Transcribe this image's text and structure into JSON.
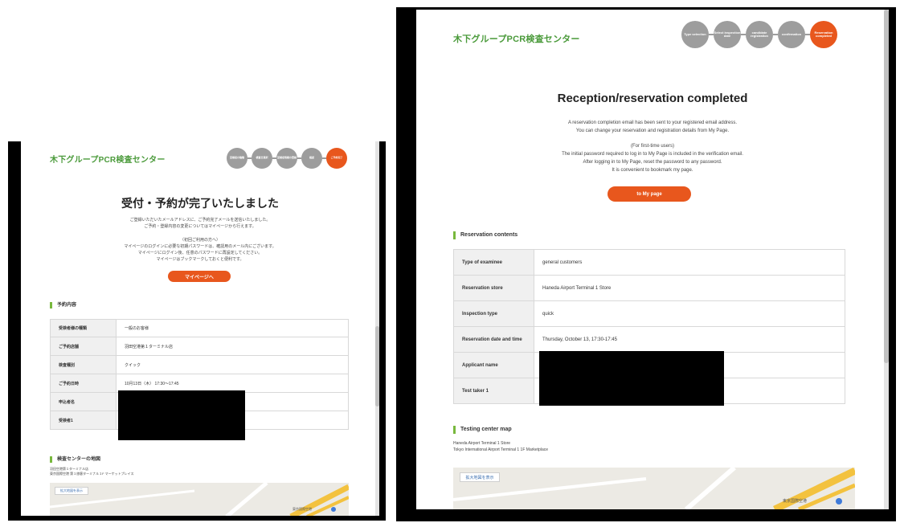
{
  "left": {
    "logo": "木下グループPCR検査センター",
    "steps": [
      "受検者の種類",
      "検査日選択",
      "受検者情報の登録",
      "確認",
      "ご予約完了"
    ],
    "heading": "受付・予約が完了いたしました",
    "message1": [
      "ご登録いただいたメールアドレスに、ご予約完了メールを送信いたしました。",
      "ご予約・登録内容の変更についてはマイページから行えます。"
    ],
    "message2": [
      "（初回ご利用の方へ）",
      "マイページのログインに必要な初期パスワードは、確認用のメール内にございます。",
      "マイページにログイン後、任意のパスワードに再設定してください。",
      "マイページはブックマークしておくと便利です。"
    ],
    "button": "マイページへ",
    "section_title": "予約内容",
    "rows": [
      {
        "label": "受検者様の種類",
        "value": "一般のお客様"
      },
      {
        "label": "ご予約店舗",
        "value": "羽田空港第１ターミナル店"
      },
      {
        "label": "検査種別",
        "value": "クイック"
      },
      {
        "label": "ご予約日時",
        "value": "10月13日（木） 17:30〜17:45"
      },
      {
        "label": "申込者名",
        "value": ""
      },
      {
        "label": "受検者1",
        "value": ""
      }
    ],
    "map_title": "検査センターの地図",
    "address": [
      "羽田空港第１ターミナル店",
      "東京国際空港 第１旅客ターミナル１F マーケットプレイス"
    ],
    "map_button": "拡大地図を表示",
    "map_label": "東京国際空港"
  },
  "right": {
    "logo": "木下グループPCR検査センター",
    "steps": [
      "Type selection",
      "Select inspection date",
      "candidate registration",
      "confirmation",
      "Reservation completed"
    ],
    "heading": "Reception/reservation completed",
    "message1": [
      "A reservation completion email has been sent to your registered email address.",
      "You can change your reservation and registration details from My Page."
    ],
    "message2": [
      "(For first-time users)",
      "The initial password required to log in to My Page is included in the verification email.",
      "After logging in to My Page, reset the password to any password.",
      "It is convenient to bookmark my page."
    ],
    "button": "to My page",
    "section_title": "Reservation contents",
    "rows": [
      {
        "label": "Type of examinee",
        "value": "general customers"
      },
      {
        "label": "Reservation store",
        "value": "Haneda Airport Terminal 1 Store"
      },
      {
        "label": "Inspection type",
        "value": "quick"
      },
      {
        "label": "Reservation date and time",
        "value": "Thursday, October 13, 17:30-17:45"
      },
      {
        "label": "Applicant name",
        "value": ""
      },
      {
        "label": "Test taker 1",
        "value": ""
      }
    ],
    "map_title": "Testing center map",
    "address": [
      "Haneda Airport Terminal 1 Store",
      "Tokyo International Airport Terminal 1 1F Marketplace"
    ],
    "map_button": "拡大地図を表示",
    "map_label": "東京国際空港"
  }
}
